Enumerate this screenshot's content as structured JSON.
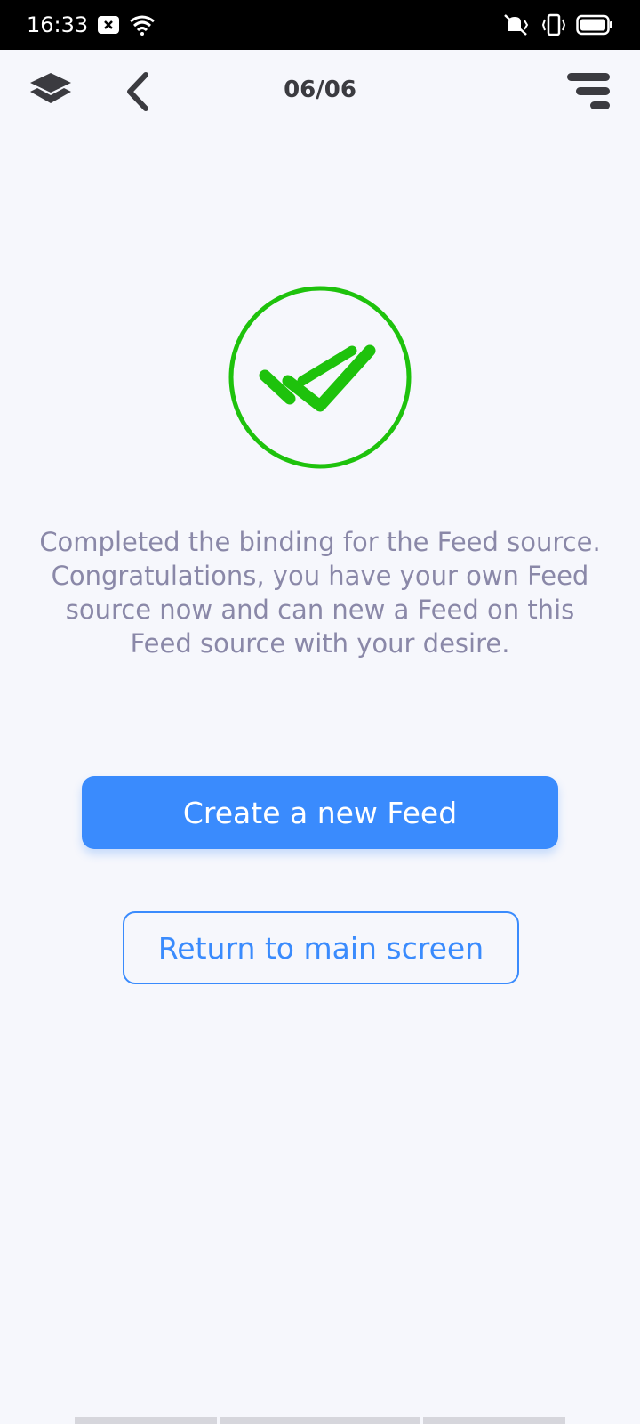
{
  "status_bar": {
    "time": "16:33",
    "icons": [
      "notification-icon",
      "wifi-icon",
      "vibrate-icon",
      "battery-icon"
    ]
  },
  "app_bar": {
    "page_counter": "06/06",
    "icons": [
      "layers-icon",
      "back-chevron-icon",
      "menu-icon"
    ]
  },
  "main": {
    "success_icon": "double-check-icon",
    "message": "Completed the binding for the Feed source.\nCongratulations, you have your own Feed\nsource now and can new a Feed on this\nFeed source with your desire.",
    "primary_button": "Create a new Feed",
    "secondary_button": "Return to main screen"
  },
  "colors": {
    "accent": "#3a8bfd",
    "success": "#1ec20c",
    "background": "#f6f7fc",
    "message_text": "#8a88a8"
  }
}
